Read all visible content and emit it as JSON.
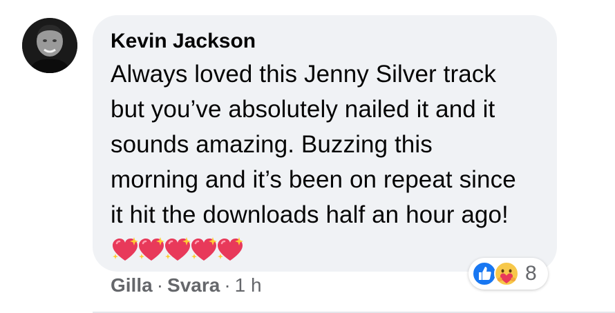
{
  "comment": {
    "author": "Kevin Jackson",
    "text": "Always loved this Jenny Silver track but you’ve absolutely nailed it and it sounds amazing. Buzzing this morning and it’s been on repeat since it hit the downloads half an hour ago! ",
    "emojis": [
      "sparkling-heart",
      "sparkling-heart",
      "sparkling-heart",
      "sparkling-heart",
      "sparkling-heart"
    ],
    "reactions": {
      "icons": [
        "like-icon",
        "care-icon"
      ],
      "count": "8"
    },
    "actions": {
      "like_label": "Gilla",
      "separator": "·",
      "reply_label": "Svara",
      "time": "1 h"
    }
  },
  "colors": {
    "bubble": "#f0f2f5",
    "like_blue": "#1877f2",
    "secondary_text": "#65676b",
    "heart_pink": "#e8395a"
  }
}
